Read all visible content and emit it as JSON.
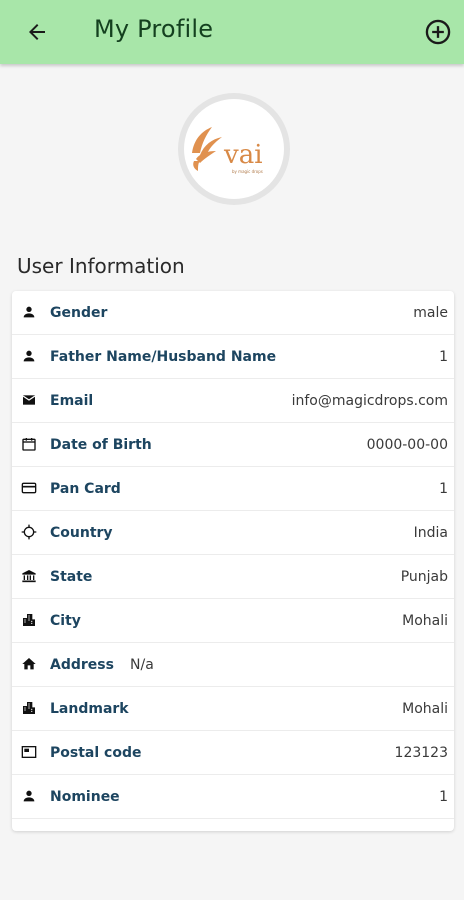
{
  "header": {
    "title": "My Profile",
    "back_icon": "arrow-back-icon",
    "add_icon": "add-circle-icon",
    "bg_color": "#a8e6a9"
  },
  "logo": {
    "text": "vai",
    "tagline": "by magic drops"
  },
  "section_title": "User Information",
  "rows": [
    {
      "icon": "person-icon",
      "label": "Gender",
      "value": "male"
    },
    {
      "icon": "person-icon",
      "label": "Father Name/Husband Name",
      "value": "1"
    },
    {
      "icon": "email-icon",
      "label": "Email",
      "value": "info@magicdrops.com"
    },
    {
      "icon": "calendar-icon",
      "label": "Date of Birth",
      "value": "0000-00-00"
    },
    {
      "icon": "card-icon",
      "label": "Pan Card",
      "value": "1"
    },
    {
      "icon": "location-target-icon",
      "label": "Country",
      "value": "India"
    },
    {
      "icon": "bank-icon",
      "label": "State",
      "value": "Punjab"
    },
    {
      "icon": "city-icon",
      "label": "City",
      "value": "Mohali"
    },
    {
      "icon": "home-icon",
      "label": "Address",
      "value": "N/a"
    },
    {
      "icon": "city-icon",
      "label": "Landmark",
      "value": "Mohali"
    },
    {
      "icon": "postal-icon",
      "label": "Postal code",
      "value": "123123"
    },
    {
      "icon": "person-icon",
      "label": "Nominee",
      "value": "1"
    }
  ]
}
